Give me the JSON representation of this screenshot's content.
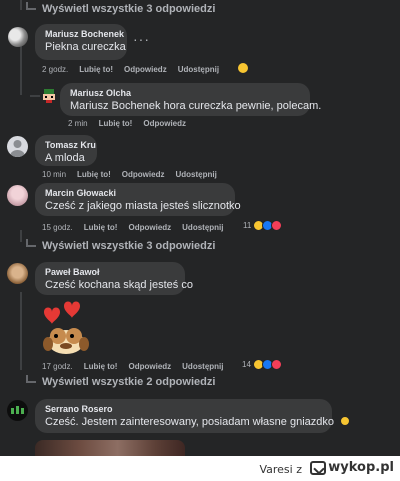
{
  "thread": {
    "view_replies_top": "Wyświetl wszystkie 3 odpowiedzi",
    "view_replies_mid": "Wyświetl wszystkie 3 odpowiedzi",
    "view_replies_bottom": "Wyświetl wszystkie 2 odpowiedzi"
  },
  "actions": {
    "like": "Lubię to!",
    "reply": "Odpowiedz",
    "share": "Udostępnij"
  },
  "comments": [
    {
      "author": "Mariusz Bochenek",
      "text": "Piekna cureczka",
      "time": "2 godz.",
      "has_share": true,
      "reaction_icon": "haha-emoji-icon"
    },
    {
      "author": "Mariusz Olcha",
      "text": "Mariusz Bochenek hora cureczka pewnie, polecam.",
      "time": "2 min",
      "has_share": false
    },
    {
      "author": "Tomasz Kru",
      "text": "A mloda",
      "time": "10 min",
      "has_share": true
    },
    {
      "author": "Marcin Głowacki",
      "text": "Cześć z jakiego miasta jesteś slicznotko",
      "time": "15 godz.",
      "has_share": true,
      "reaction_count": "11"
    },
    {
      "author": "Paweł Bawoł",
      "text": "Cześć kochana skąd jesteś co",
      "time": "17 godz.",
      "has_share": true,
      "reaction_count": "14",
      "sticker": "hearts-puppy-sticker"
    },
    {
      "author": "Serrano Rosero",
      "text": "Cześć. Jestem zainteresowany, posiadam własne gniazdko",
      "trailing_emoji": "smile-emoji-icon"
    }
  ],
  "footer": {
    "user": "Varesi",
    "separator": "z",
    "site": "wykop.pl"
  },
  "colors": {
    "panel_bg": "#242526",
    "bubble_bg": "#3a3b3c",
    "meta_text": "#b0b3b8"
  }
}
